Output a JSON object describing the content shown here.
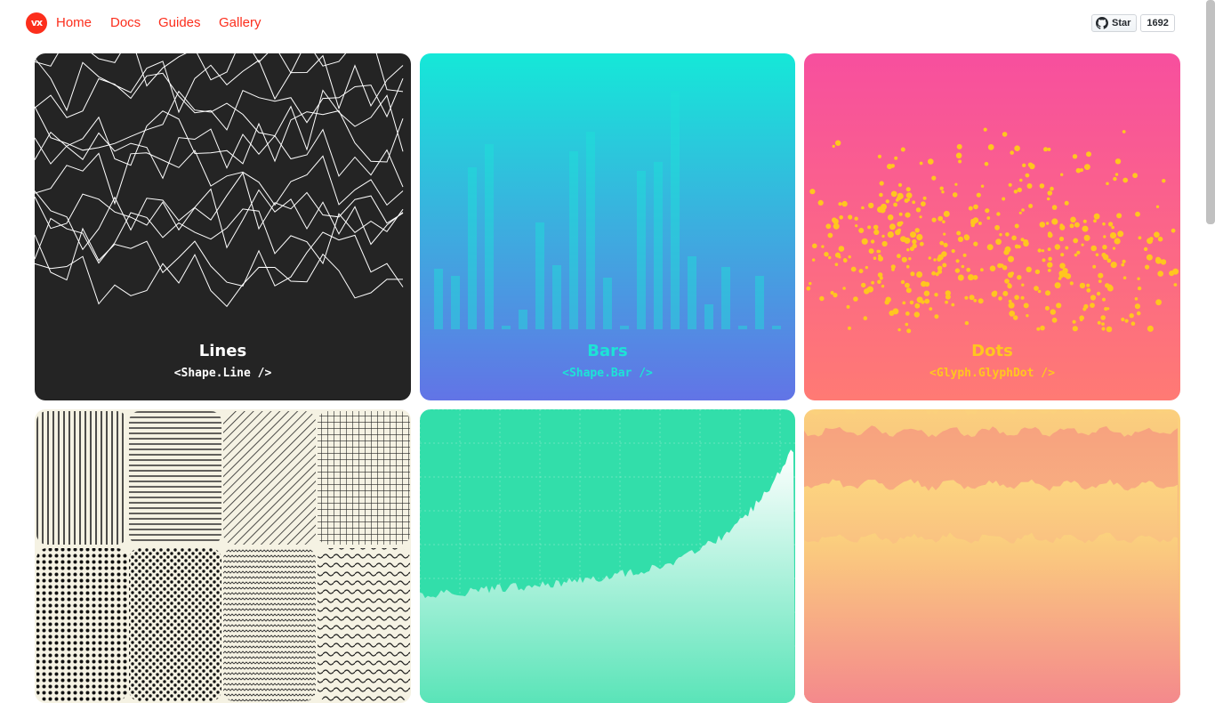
{
  "nav": {
    "logo": "vx",
    "links": [
      "Home",
      "Docs",
      "Guides",
      "Gallery"
    ]
  },
  "github": {
    "star_label": "Star",
    "count": "1692"
  },
  "tiles": [
    {
      "title": "Lines",
      "subtitle": "<Shape.Line />",
      "title_color": "#ffffff",
      "subtitle_color": "#ffffff"
    },
    {
      "title": "Bars",
      "subtitle": "<Shape.Bar />",
      "title_color": "#1de3d6",
      "subtitle_color": "#1de3d6"
    },
    {
      "title": "Dots",
      "subtitle": "<Glyph.GlyphDot />",
      "title_color": "#ffc61f",
      "subtitle_color": "#ffc61f"
    },
    {
      "title": "",
      "subtitle": ""
    },
    {
      "title": "",
      "subtitle": ""
    },
    {
      "title": "",
      "subtitle": ""
    }
  ],
  "colors": {
    "brand": "#fc2e1c",
    "lines_bg": "#242424",
    "bars_gradient": [
      "#15e8d8",
      "#6274e6"
    ],
    "dots_gradient": [
      "#f74f9e",
      "#ff7a74"
    ],
    "dot_color": "#ffc61f",
    "area_bg": "#32deaa",
    "pattern_bg": "#f5f2e3",
    "stream_colors": [
      "#fbd17d",
      "#f4898c"
    ]
  },
  "icons": {
    "github": "github-icon"
  }
}
